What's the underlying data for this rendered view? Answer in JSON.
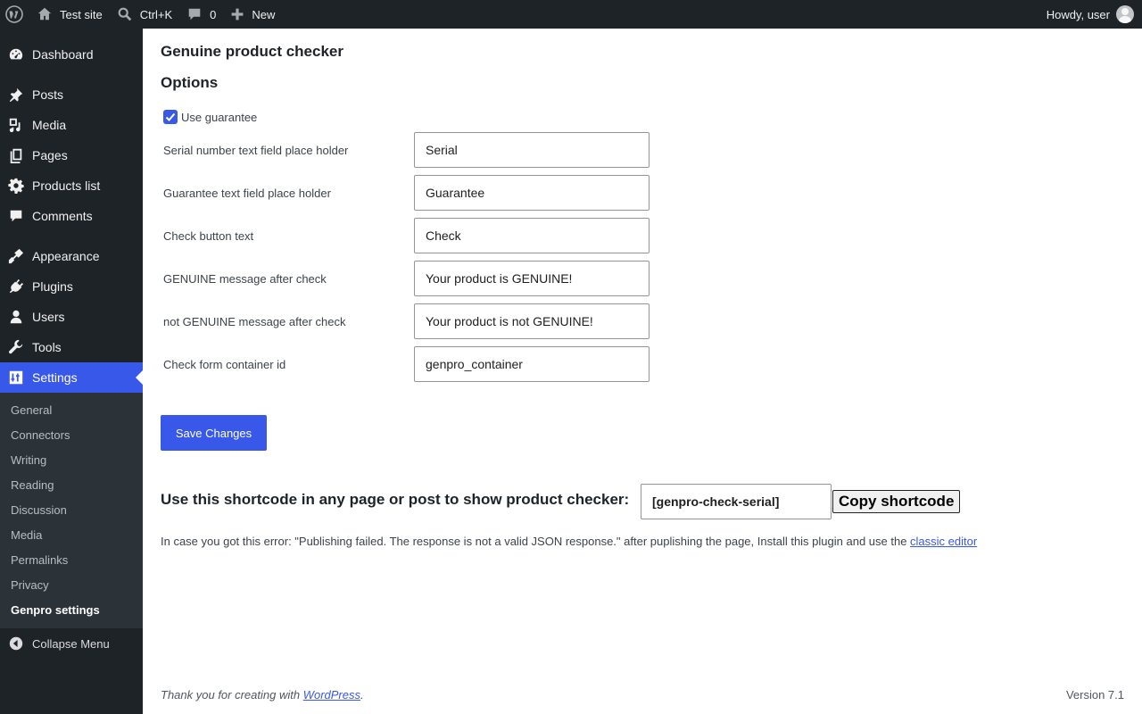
{
  "admin_bar": {
    "site_name": "Test site",
    "search_shortcut": "Ctrl+K",
    "comments_count": "0",
    "new_label": "New",
    "greeting": "Howdy, user"
  },
  "menu": {
    "items": [
      {
        "label": "Dashboard",
        "icon": "dashboard-icon"
      },
      {
        "label": "Posts",
        "icon": "pin-icon"
      },
      {
        "label": "Media",
        "icon": "media-icon"
      },
      {
        "label": "Pages",
        "icon": "pages-icon"
      },
      {
        "label": "Products list",
        "icon": "gear-icon"
      },
      {
        "label": "Comments",
        "icon": "comment-icon"
      },
      {
        "label": "Appearance",
        "icon": "brush-icon"
      },
      {
        "label": "Plugins",
        "icon": "plug-icon"
      },
      {
        "label": "Users",
        "icon": "user-icon"
      },
      {
        "label": "Tools",
        "icon": "wrench-icon"
      },
      {
        "label": "Settings",
        "icon": "sliders-icon"
      }
    ],
    "settings_submenu": [
      "General",
      "Connectors",
      "Writing",
      "Reading",
      "Discussion",
      "Media",
      "Permalinks",
      "Privacy",
      "Genpro settings"
    ],
    "collapse_label": "Collapse Menu"
  },
  "page": {
    "title": "Genuine product checker",
    "section": "Options",
    "use_guarantee_label": "Use guarantee",
    "use_guarantee_checked": true,
    "fields": [
      {
        "label": "Serial number text field place holder",
        "value": "Serial"
      },
      {
        "label": "Guarantee text field place holder",
        "value": "Guarantee"
      },
      {
        "label": "Check button text",
        "value": "Check"
      },
      {
        "label": "GENUINE message after check",
        "value": "Your product is GENUINE!"
      },
      {
        "label": "not GENUINE message after check",
        "value": "Your product is not GENUINE!"
      },
      {
        "label": "Check form container id",
        "value": "genpro_container"
      }
    ],
    "save_label": "Save Changes",
    "shortcode_heading": "Use this shortcode in any page or post to show product checker:",
    "shortcode_value": "[genpro-check-serial]",
    "copy_label": "Copy shortcode",
    "note_text": "In case you got this error: \"Publishing failed. The response is not a valid JSON response.\" after puplishing the page, Install this plugin and use the ",
    "note_link": "classic editor"
  },
  "footer": {
    "thanks_text": "Thank you for creating with ",
    "thanks_link": "WordPress",
    "thanks_end": ".",
    "version": "Version 7.1"
  },
  "colors": {
    "admin_bg": "#1d2327",
    "submenu_bg": "#2c3338",
    "accent": "#3858e9"
  }
}
